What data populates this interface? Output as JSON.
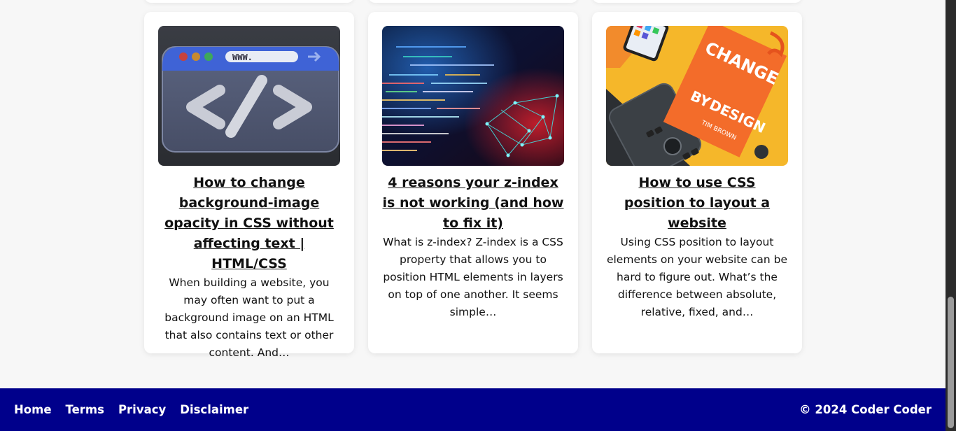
{
  "cards": [
    {
      "title": "How to change background-image opacity in CSS without affecting text | HTML/CSS",
      "excerpt": "When building a website, you may often want to put a background image on an HTML that also contains text or other content. And…",
      "thumb_text": "WWW."
    },
    {
      "title": "4 reasons your z-index is not working (and how to fix it)",
      "excerpt": "What is z-index? Z-index is a CSS property that allows you to position HTML elements in layers on top of one another. It seems simple…"
    },
    {
      "title": "How to use CSS position to layout a website",
      "excerpt": "Using CSS position to layout elements on your website can be hard to figure out. What’s the difference between absolute, relative, fixed, and…",
      "book_words": [
        "CHANGE",
        "BY",
        "DESIGN",
        "TIM BROWN"
      ]
    }
  ],
  "footer": {
    "nav": [
      "Home",
      "Terms",
      "Privacy",
      "Disclaimer"
    ],
    "copyright": "© 2024 Coder Coder",
    "background": "#00008b"
  },
  "colors": {
    "page_bg": "#f7f7f7",
    "card_bg": "#ffffff",
    "scrollbar_track": "#2b2b2b",
    "scrollbar_thumb": "#9b9b9b"
  }
}
